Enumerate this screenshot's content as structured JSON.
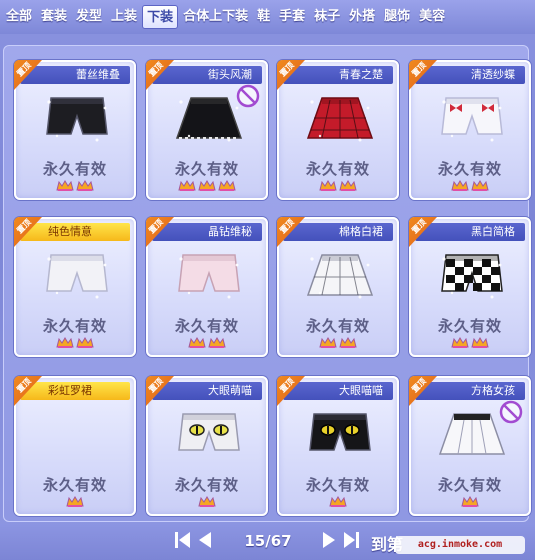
{
  "tabs": [
    {
      "label": "全部",
      "active": false
    },
    {
      "label": "套装",
      "active": false
    },
    {
      "label": "发型",
      "active": false
    },
    {
      "label": "上装",
      "active": false
    },
    {
      "label": "下装",
      "active": true
    },
    {
      "label": "合体上下装",
      "active": false
    },
    {
      "label": "鞋",
      "active": false
    },
    {
      "label": "手套",
      "active": false
    },
    {
      "label": "袜子",
      "active": false
    },
    {
      "label": "外搭",
      "active": false
    },
    {
      "label": "腿饰",
      "active": false
    },
    {
      "label": "美容",
      "active": false
    }
  ],
  "ribbon_label": "置顶",
  "items": [
    {
      "name": "蕾丝维叠",
      "validity": "永久有效",
      "crowns": 2,
      "highlight": false,
      "forbidden": false,
      "icon": "black-lace-shorts-icon"
    },
    {
      "name": "街头风潮",
      "validity": "永久有效",
      "crowns": 3,
      "highlight": false,
      "forbidden": true,
      "icon": "black-skirt-icon"
    },
    {
      "name": "青春之楚",
      "validity": "永久有效",
      "crowns": 2,
      "highlight": false,
      "forbidden": false,
      "icon": "red-plaid-skirt-icon"
    },
    {
      "name": "清透纱蝶",
      "validity": "永久有效",
      "crowns": 2,
      "highlight": false,
      "forbidden": false,
      "icon": "white-bow-shorts-icon"
    },
    {
      "name": "纯色情意",
      "validity": "永久有效",
      "crowns": 2,
      "highlight": true,
      "forbidden": false,
      "icon": "white-shorts-icon"
    },
    {
      "name": "晶钻维秘",
      "validity": "永久有效",
      "crowns": 2,
      "highlight": false,
      "forbidden": false,
      "icon": "pink-shorts-icon"
    },
    {
      "name": "棉格白裙",
      "validity": "永久有效",
      "crowns": 2,
      "highlight": false,
      "forbidden": false,
      "icon": "white-plaid-skirt-icon"
    },
    {
      "name": "黑白简格",
      "validity": "永久有效",
      "crowns": 2,
      "highlight": false,
      "forbidden": false,
      "icon": "checkered-shorts-icon"
    },
    {
      "name": "彩虹罗裙",
      "validity": "永久有效",
      "crowns": 1,
      "highlight": true,
      "forbidden": false,
      "icon": "rainbow-skirt-icon"
    },
    {
      "name": "大眼萌喵",
      "validity": "永久有效",
      "crowns": 1,
      "highlight": false,
      "forbidden": false,
      "icon": "white-cat-shorts-icon"
    },
    {
      "name": "大眼喵喵",
      "validity": "永久有效",
      "crowns": 1,
      "highlight": false,
      "forbidden": false,
      "icon": "black-cat-shorts-icon"
    },
    {
      "name": "方格女孩",
      "validity": "永久有效",
      "crowns": 1,
      "highlight": false,
      "forbidden": true,
      "icon": "white-pleated-skirt-icon"
    }
  ],
  "pager": {
    "page_text": "15/67",
    "goto_label": "到第",
    "watermark": "acg.inmoke.com"
  },
  "colors": {
    "background": "#8a93e0",
    "tab_active": "#3d4aa8",
    "highlight_bar": "#f6b81a",
    "ribbon": "#e0611b"
  }
}
